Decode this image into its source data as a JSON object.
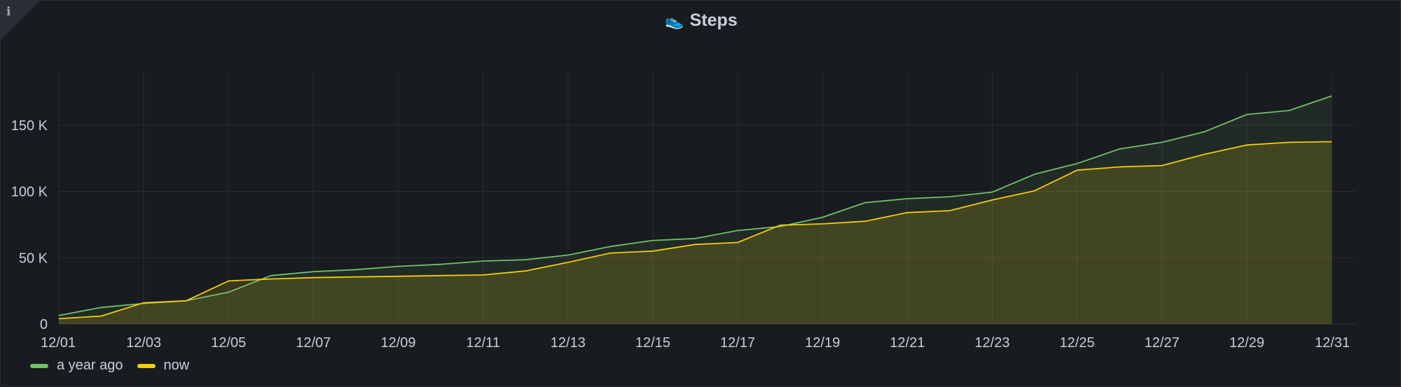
{
  "panel": {
    "title": "Steps",
    "title_icon": "shoe-icon",
    "info_icon": "i"
  },
  "colors": {
    "background": "#181b1f",
    "grid": "#2a2d33",
    "a_year_ago": "#73bf69",
    "now": "#f2cc0c",
    "axis_text": "#ccccdc"
  },
  "legend": {
    "placement": "bottom-left",
    "items": [
      {
        "name": "a year ago",
        "color": "#73bf69"
      },
      {
        "name": "now",
        "color": "#f2cc0c"
      }
    ]
  },
  "chart_data": {
    "type": "area",
    "title": "Steps",
    "xlabel": "",
    "ylabel": "",
    "grid": true,
    "ylim": [
      0,
      190000
    ],
    "x": [
      "12/01",
      "12/02",
      "12/03",
      "12/04",
      "12/05",
      "12/06",
      "12/07",
      "12/08",
      "12/09",
      "12/10",
      "12/11",
      "12/12",
      "12/13",
      "12/14",
      "12/15",
      "12/16",
      "12/17",
      "12/18",
      "12/19",
      "12/20",
      "12/21",
      "12/22",
      "12/23",
      "12/24",
      "12/25",
      "12/26",
      "12/27",
      "12/28",
      "12/29",
      "12/30",
      "12/31"
    ],
    "x_tick_labels": [
      "12/01",
      "12/03",
      "12/05",
      "12/07",
      "12/09",
      "12/11",
      "12/13",
      "12/15",
      "12/17",
      "12/19",
      "12/21",
      "12/23",
      "12/25",
      "12/27",
      "12/29",
      "12/31"
    ],
    "y_ticks": [
      0,
      50000,
      100000,
      150000
    ],
    "y_tick_labels": [
      "0",
      "50 K",
      "100 K",
      "150 K"
    ],
    "series": [
      {
        "name": "a year ago",
        "color": "#73bf69",
        "values": [
          6500,
          12500,
          15500,
          17500,
          24000,
          36500,
          39500,
          41000,
          43500,
          45000,
          47500,
          48500,
          52000,
          58500,
          63000,
          64500,
          70500,
          73500,
          80500,
          91500,
          94500,
          96000,
          99500,
          113000,
          121000,
          132000,
          137000,
          145000,
          158000,
          161000,
          172000
        ]
      },
      {
        "name": "now",
        "color": "#f2cc0c",
        "values": [
          4000,
          6000,
          16000,
          17500,
          32500,
          34000,
          35000,
          35500,
          36000,
          36500,
          37000,
          40000,
          46500,
          53500,
          55000,
          60000,
          61500,
          74500,
          75500,
          77500,
          84000,
          85500,
          93500,
          100500,
          116000,
          118500,
          119500,
          128000,
          135000,
          137000,
          137500
        ]
      }
    ]
  }
}
